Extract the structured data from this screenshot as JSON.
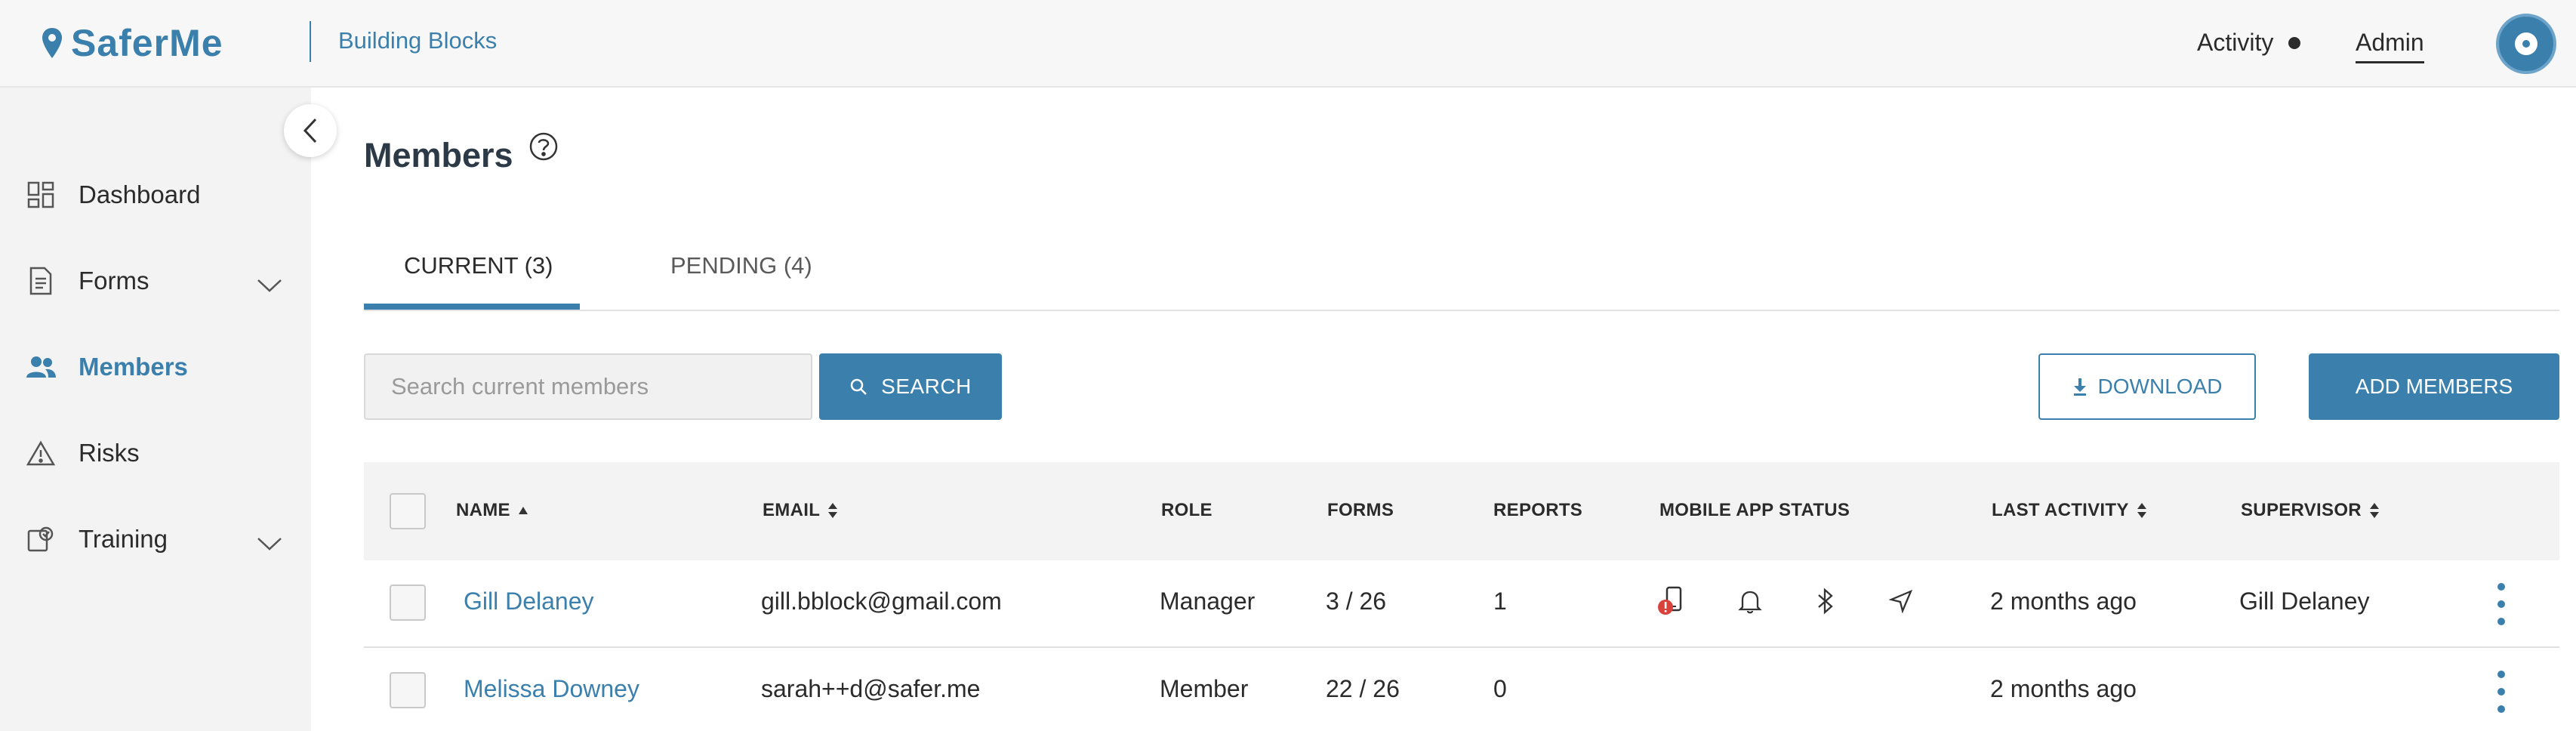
{
  "header": {
    "brand": "SaferMe",
    "org_name": "Building Blocks",
    "activity_label": "Activity",
    "admin_label": "Admin",
    "brand_color": "#3b80ac"
  },
  "sidebar": {
    "items": [
      {
        "label": "Dashboard",
        "icon": "dashboard-grid-icon",
        "active": false,
        "expandable": false
      },
      {
        "label": "Forms",
        "icon": "form-document-icon",
        "active": false,
        "expandable": true
      },
      {
        "label": "Members",
        "icon": "people-icon",
        "active": true,
        "expandable": false
      },
      {
        "label": "Risks",
        "icon": "warning-triangle-icon",
        "active": false,
        "expandable": false
      },
      {
        "label": "Training",
        "icon": "training-icon",
        "active": false,
        "expandable": true
      }
    ]
  },
  "main": {
    "title": "Members",
    "tabs": [
      {
        "label": "CURRENT (3)",
        "active": true
      },
      {
        "label": "PENDING (4)",
        "active": false
      }
    ],
    "search": {
      "placeholder": "Search current members",
      "button_label": "SEARCH"
    },
    "download_label": "DOWNLOAD",
    "add_members_label": "ADD MEMBERS"
  },
  "table": {
    "columns": [
      "NAME",
      "EMAIL",
      "ROLE",
      "FORMS",
      "REPORTS",
      "MOBILE APP STATUS",
      "LAST ACTIVITY",
      "SUPERVISOR"
    ],
    "rows": [
      {
        "name": "Gill Delaney",
        "email": "gill.bblock@gmail.com",
        "role": "Manager",
        "forms": "3 / 26",
        "reports": "1",
        "status_icons": [
          "phone-alert-icon",
          "bell-icon",
          "bluetooth-icon",
          "location-arrow-icon"
        ],
        "last_activity": "2 months ago",
        "supervisor": "Gill Delaney"
      },
      {
        "name": "Melissa Downey",
        "email": "sarah++d@safer.me",
        "role": "Member",
        "forms": "22 / 26",
        "reports": "0",
        "status_icons": [],
        "last_activity": "2 months ago",
        "supervisor": ""
      }
    ]
  }
}
